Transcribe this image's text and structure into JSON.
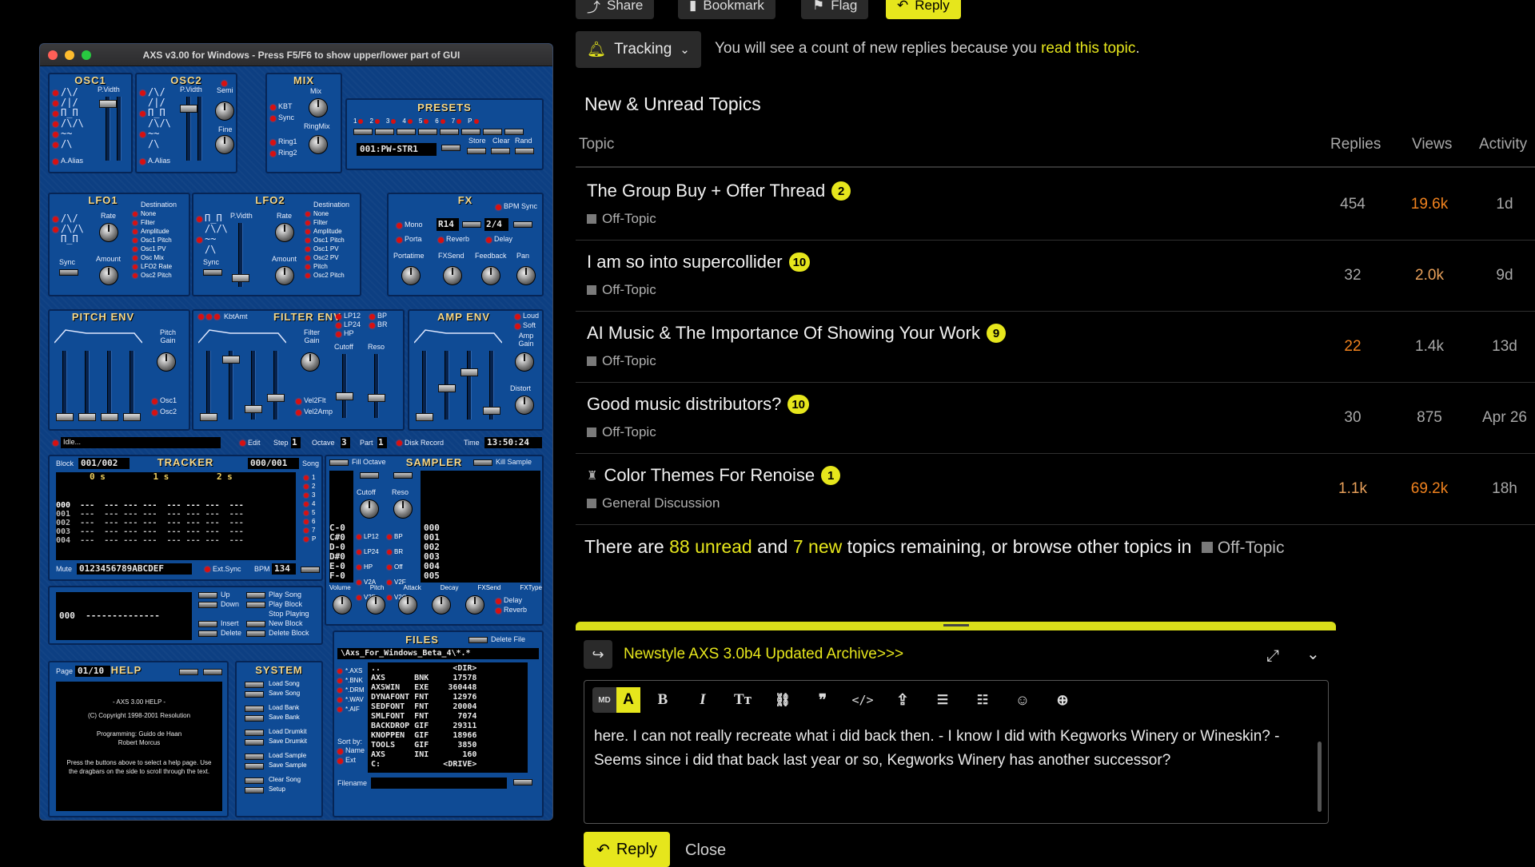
{
  "axs": {
    "title": "AXS v3.00 for Windows - Press F5/F6 to show upper/lower part of GUI",
    "osc1": {
      "title": "OSC1",
      "pwidth": "P.Vidth",
      "alias": "A.Alias"
    },
    "osc2": {
      "title": "OSC2",
      "pwidth": "P.Vidth",
      "semi": "Semi",
      "fine": "Fine",
      "alias": "A.Alias"
    },
    "mix": {
      "title": "MIX",
      "mix": "Mix",
      "kbt": "KBT",
      "sync": "Sync",
      "ringmix": "RingMix",
      "ring1": "Ring1",
      "ring2": "Ring2"
    },
    "presets": {
      "title": "PRESETS",
      "nums": [
        "1",
        "2",
        "3",
        "4",
        "5",
        "6",
        "7",
        "P"
      ],
      "lcd": "001:PW-STR1",
      "store": "Store",
      "clear": "Clear",
      "rand": "Rand"
    },
    "lfo1": {
      "title": "LFO1",
      "rate": "Rate",
      "amount": "Amount",
      "sync": "Sync",
      "destination": "Destination",
      "dests": [
        "None",
        "Filter",
        "Amplitude",
        "Osc1 Pitch",
        "Osc1 PV",
        "Osc Mix",
        "LFO2 Rate",
        "Osc2 Pitch"
      ]
    },
    "lfo2": {
      "title": "LFO2",
      "pwidth": "P.Vidth",
      "rate": "Rate",
      "amount": "Amount",
      "sync": "Sync",
      "destination": "Destination",
      "dests": [
        "None",
        "Filter",
        "Amplitude",
        "Osc1 Pitch",
        "Osc1 PV",
        "Osc2 PV",
        "Pitch",
        "Osc2 Pitch"
      ]
    },
    "fx": {
      "title": "FX",
      "bpm_sync": "BPM Sync",
      "mono": "Mono",
      "r14": "R14",
      "ratio": "2/4",
      "porta": "Porta",
      "reverb": "Reverb",
      "delay": "Delay",
      "portatime": "Portatime",
      "fxsend": "FXSend",
      "feedback": "Feedback",
      "pan": "Pan"
    },
    "pitchenv": {
      "title": "PITCH ENV",
      "gain": "Pitch Gain",
      "osc1": "Osc1",
      "osc2": "Osc2"
    },
    "filterenv": {
      "title": "FILTER ENV",
      "kbtamt": "KbtAmt",
      "gain": "Filter Gain",
      "lp12": "LP12",
      "bp": "BP",
      "lp24": "LP24",
      "br": "BR",
      "hp": "HP",
      "cutoff": "Cutoff",
      "reso": "Reso",
      "vel2flt": "Vel2Flt",
      "vel2amp": "Vel2Amp"
    },
    "ampenv": {
      "title": "AMP ENV",
      "loud": "Loud",
      "soft": "Soft",
      "gain": "Amp Gain",
      "distort": "Distort"
    },
    "status": {
      "idle": "Idle...",
      "edit": "Edit",
      "step": "Step",
      "step_val": "1",
      "octave": "Octave",
      "octave_val": "3",
      "part": "Part",
      "part_val": "1",
      "disk": "Disk Record",
      "time": "Time",
      "time_val": "13:50:24"
    },
    "tracker": {
      "title": "TRACKER",
      "block": "Block",
      "block_val": "001/002",
      "pos": "000/001",
      "song": "Song",
      "cols": [
        "0",
        "1",
        "2"
      ],
      "rows": [
        "000",
        "001",
        "002",
        "003",
        "004"
      ],
      "song_nums": [
        "1",
        "2",
        "3",
        "4",
        "5",
        "6",
        "7",
        "P"
      ],
      "mute": "Mute",
      "mute_val": "0123456789ABCDEF",
      "extsync": "Ext.Sync",
      "bpm": "BPM",
      "bpm_val": "134"
    },
    "sampler": {
      "title": "SAMPLER",
      "fill_octave": "Fill Octave",
      "kill_sample": "Kill Sample",
      "cutoff": "Cutoff",
      "reso": "Reso",
      "notes": [
        "C-0",
        "C#0",
        "D-0",
        "D#0",
        "E-0",
        "F-0"
      ],
      "nums": [
        "000",
        "001",
        "002",
        "003",
        "004",
        "005"
      ],
      "filters": [
        "LP12",
        "BP",
        "LP24",
        "BR",
        "HP",
        "Off",
        "V2A",
        "V2F",
        "V2D",
        "V2O"
      ],
      "knobs": [
        "Volume",
        "Pitch",
        "Attack",
        "Decay",
        "FXSend",
        "FXType"
      ],
      "delay": "Delay",
      "reverb": "Reverb"
    },
    "song": {
      "pos": "000",
      "pattern": "--------------",
      "up": "Up",
      "down": "Down",
      "insert": "Insert",
      "delete": "Delete",
      "play_song": "Play Song",
      "play_block": "Play Block",
      "stop_playing": "Stop Playing",
      "new_block": "New Block",
      "delete_block": "Delete Block"
    },
    "help": {
      "title": "HELP",
      "page": "Page",
      "page_val": "01/10",
      "lines": [
        "- AXS 3.00 HELP -",
        "(C) Copyright 1998-2001 Resolution",
        "Programming: Guido de Haan",
        "Robert Morcus",
        "Press the buttons above to select a help page. Use the dragbars on the side to scroll through the text."
      ]
    },
    "system": {
      "title": "SYSTEM",
      "items": [
        "Load Song",
        "Save Song",
        "Load Bank",
        "Save Bank",
        "Load Drumkit",
        "Save Drumkit",
        "Load Sample",
        "Save Sample",
        "Clear Song",
        "Setup"
      ]
    },
    "files": {
      "title": "FILES",
      "delete_file": "Delete File",
      "path": "\\Axs_For_Windows_Beta_4\\*.*",
      "types": [
        "*.AXS",
        "*.BNK",
        "*.DRM",
        "*.WAV",
        "*.AIF"
      ],
      "sortby": "Sort by:",
      "name": "Name",
      "ext": "Ext",
      "filename": "Filename",
      "list": [
        [
          "..",
          "",
          "<DIR>"
        ],
        [
          "AXS",
          "BNK",
          "17578"
        ],
        [
          "AXSWIN",
          "EXE",
          "360448"
        ],
        [
          "DYNAFONT",
          "FNT",
          "12976"
        ],
        [
          "SEDFONT",
          "FNT",
          "20004"
        ],
        [
          "SMLFONT",
          "FNT",
          "7074"
        ],
        [
          "BACKDROP",
          "GIF",
          "29311"
        ],
        [
          "KNOPPEN",
          "GIF",
          "18966"
        ],
        [
          "TOOLS",
          "GIF",
          "3850"
        ],
        [
          "AXS",
          "INI",
          "160"
        ],
        [
          "C:",
          "",
          "<DRIVE>"
        ]
      ]
    }
  },
  "forum": {
    "top_buttons": [
      "Share",
      "Bookmark",
      "Flag",
      "Reply"
    ],
    "tracking": {
      "label": "Tracking",
      "message": "You will see a count of new replies because you ",
      "link": "read this topic",
      "end": "."
    },
    "section_title": "New & Unread Topics",
    "columns": {
      "topic": "Topic",
      "replies": "Replies",
      "views": "Views",
      "activity": "Activity"
    },
    "topics": [
      {
        "title": "The Group Buy + Offer Thread",
        "badge": "2",
        "category": "Off-Topic",
        "replies": "454",
        "views": "19.6k",
        "activity": "1d"
      },
      {
        "title": "I am so into supercollider",
        "badge": "10",
        "category": "Off-Topic",
        "replies": "32",
        "views": "2.0k",
        "activity": "9d"
      },
      {
        "title": "AI Music & The Importance Of Showing Your Work",
        "badge": "9",
        "category": "Off-Topic",
        "replies": "22",
        "views": "1.4k",
        "activity": "13d"
      },
      {
        "title": "Good music distributors?",
        "badge": "10",
        "category": "Off-Topic",
        "replies": "30",
        "views": "875",
        "activity": "Apr 26"
      },
      {
        "title": "Color Themes For Renoise",
        "badge": "1",
        "category": "General Discussion",
        "replies": "1.1k",
        "views": "69.2k",
        "activity": "18h"
      }
    ],
    "colors": {
      "accent": "#e6e61c",
      "hot": "#f0821e",
      "warm": "#e8a05a",
      "muted": "#a8a8a8"
    },
    "remaining": {
      "a": "There are ",
      "unread": "88 unread",
      "b": " and ",
      "new": "7 new",
      "c": " topics remaining, or browse other topics in ",
      "cat": "Off-Topic"
    },
    "composer": {
      "reply_to": "Newstyle AXS 3.0b4 Updated Archive>>>",
      "text": "here. I can not really recreate what i did back then. - I know I did with Kegworks Winery or Wineskin? - Seems since i did that back last year or so, Kegworks Winery has another successor?",
      "reply": "Reply",
      "close": "Close"
    }
  }
}
